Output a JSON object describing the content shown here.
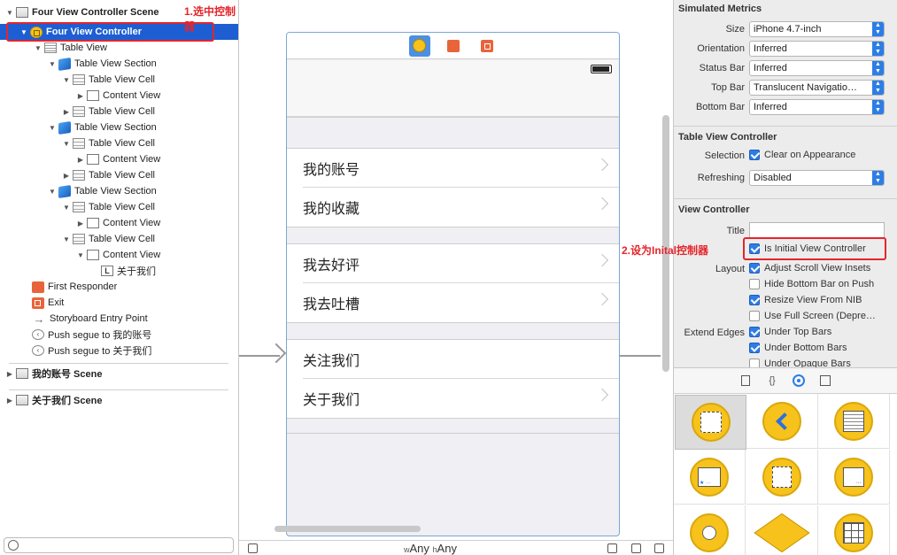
{
  "outline": {
    "rows": [
      {
        "label": "Four View Controller Scene"
      },
      {
        "label": "Four View Controller"
      },
      {
        "label": "Table View"
      },
      {
        "label": "Table View Section"
      },
      {
        "label": "Table View Cell"
      },
      {
        "label": "Content View"
      },
      {
        "label": "Table View Cell"
      },
      {
        "label": "Table View Section"
      },
      {
        "label": "Table View Cell"
      },
      {
        "label": "Content View"
      },
      {
        "label": "Table View Cell"
      },
      {
        "label": "Table View Section"
      },
      {
        "label": "Table View Cell"
      },
      {
        "label": "Content View"
      },
      {
        "label": "Table View Cell"
      },
      {
        "label": "Content View"
      },
      {
        "label": "关于我们"
      },
      {
        "label": "First Responder"
      },
      {
        "label": "Exit"
      },
      {
        "label": "Storyboard Entry Point"
      },
      {
        "label": "Push segue to 我的账号"
      },
      {
        "label": "Push segue to 关于我们"
      },
      {
        "label": "我的账号 Scene"
      },
      {
        "label": "关于我们 Scene"
      }
    ],
    "annotation": "1.选中控制器"
  },
  "canvas": {
    "cells": [
      {
        "label": "我的账号"
      },
      {
        "label": "我的收藏"
      },
      {
        "label": "我去好评"
      },
      {
        "label": "我去吐槽"
      },
      {
        "label": "关注我们"
      },
      {
        "label": "关于我们"
      }
    ],
    "size_class": {
      "w_prefix": "w",
      "w_value": "Any",
      "h_prefix": "h",
      "h_value": "Any"
    }
  },
  "inspector": {
    "simulated_metrics": {
      "title": "Simulated Metrics",
      "fields": [
        {
          "label": "Size",
          "value": "iPhone 4.7-inch"
        },
        {
          "label": "Orientation",
          "value": "Inferred"
        },
        {
          "label": "Status Bar",
          "value": "Inferred"
        },
        {
          "label": "Top Bar",
          "value": "Translucent Navigatio…"
        },
        {
          "label": "Bottom Bar",
          "value": "Inferred"
        }
      ]
    },
    "table_view_controller": {
      "title": "Table View Controller",
      "selection_label": "Selection",
      "selection_value": "Clear on Appearance",
      "refreshing_label": "Refreshing",
      "refreshing_value": "Disabled"
    },
    "view_controller": {
      "title": "View Controller",
      "title_label": "Title",
      "title_value": "",
      "initial_label": "Is Initial View Controller",
      "layout_label": "Layout",
      "layout_options": [
        {
          "label": "Adjust Scroll View Insets",
          "checked": true
        },
        {
          "label": "Hide Bottom Bar on Push",
          "checked": false
        },
        {
          "label": "Resize View From NIB",
          "checked": true
        },
        {
          "label": "Use Full Screen (Depre…",
          "checked": false
        }
      ],
      "extend_label": "Extend Edges",
      "extend_options": [
        {
          "label": "Under Top Bars",
          "checked": true
        },
        {
          "label": "Under Bottom Bars",
          "checked": true
        },
        {
          "label": "Under Opaque Bars",
          "checked": false
        }
      ],
      "annotation": "2.设为Inital控制器"
    }
  },
  "library": {
    "tab_braces": "{}"
  },
  "colors": {
    "selection": "#1d5fd3",
    "annotation_red": "#e4252b",
    "accent_blue": "#2d7de6",
    "vc_yellow": "#f6c21b"
  }
}
